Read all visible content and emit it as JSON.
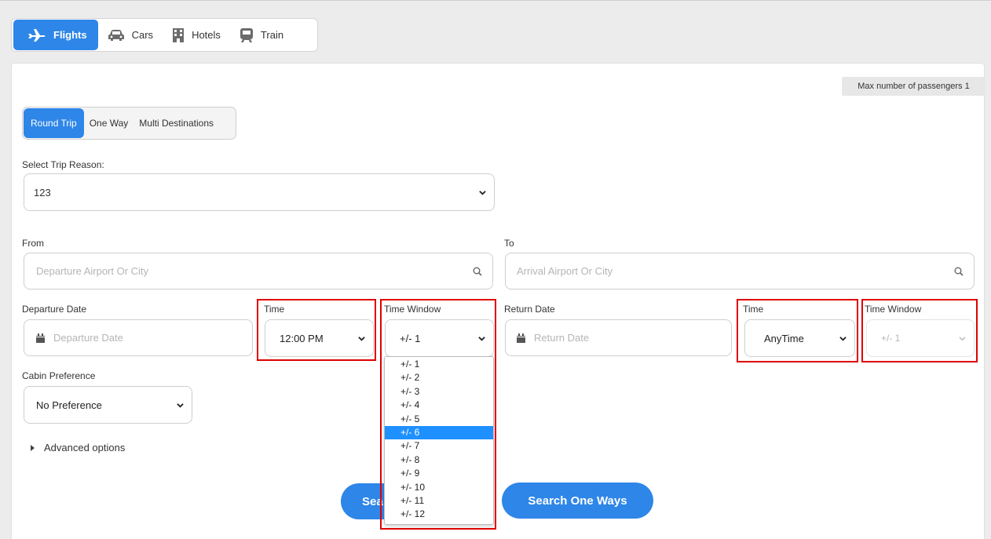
{
  "nav": {
    "tabs": [
      {
        "label": "Flights",
        "icon": "plane-icon",
        "active": true
      },
      {
        "label": "Cars",
        "icon": "car-icon",
        "active": false
      },
      {
        "label": "Hotels",
        "icon": "building-icon",
        "active": false
      },
      {
        "label": "Train",
        "icon": "train-icon",
        "active": false
      }
    ]
  },
  "form": {
    "max_passengers": "Max number of passengers 1",
    "trip_types": [
      "Round Trip",
      "One Way",
      "Multi Destinations"
    ],
    "trip_reason_label": "Select Trip Reason:",
    "trip_reason_value": "123",
    "from_label": "From",
    "from_placeholder": "Departure Airport Or City",
    "to_label": "To",
    "to_placeholder": "Arrival Airport Or City",
    "departure_date_label": "Departure Date",
    "departure_date_placeholder": "Departure Date",
    "departure_time_label": "Time",
    "departure_time_value": "12:00 PM",
    "departure_window_label": "Time Window",
    "departure_window_value": "+/- 1",
    "return_date_label": "Return Date",
    "return_date_placeholder": "Return Date",
    "return_time_label": "Time",
    "return_time_value": "AnyTime",
    "return_window_label": "Time Window",
    "return_window_value": "+/- 1",
    "cabin_label": "Cabin Preference",
    "cabin_value": "No Preference",
    "advanced_label": "Advanced options",
    "search_button": "Sea",
    "search_one_ways_button": "Search One Ways"
  },
  "time_window_options": [
    "+/- 1",
    "+/- 2",
    "+/- 3",
    "+/- 4",
    "+/- 5",
    "+/- 6",
    "+/- 7",
    "+/- 8",
    "+/- 9",
    "+/- 10",
    "+/- 11",
    "+/- 12"
  ],
  "time_window_highlighted": "+/- 6",
  "colors": {
    "accent": "#2e86e8",
    "highlight_box": "#e00000",
    "option_highlight": "#1e90ff"
  }
}
